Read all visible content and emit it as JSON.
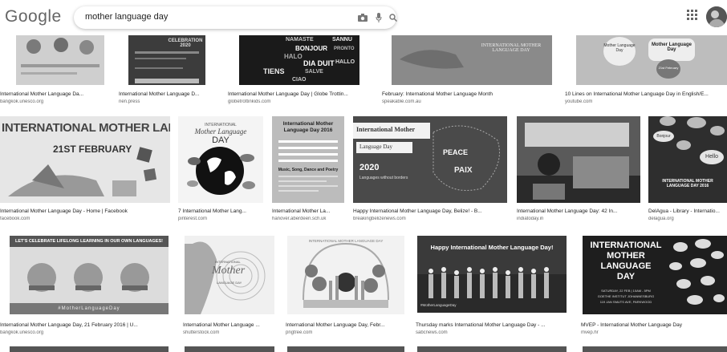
{
  "header": {
    "logo": "Google",
    "search_value": "mother language day",
    "icons": [
      "camera-icon",
      "mic-icon",
      "search-icon",
      "apps-icon",
      "avatar"
    ]
  },
  "rows": [
    {
      "items": [
        {
          "title": "International Mother Language Da...",
          "source": "bangkok.unesco.org"
        },
        {
          "title": "International Mother Language D...",
          "source": "nen.press"
        },
        {
          "title": "International Mother Language Day | Globe Trottin...",
          "source": "globetrottinkids.com"
        },
        {
          "title": "February: International Mother Language Month",
          "source": "speakable.com.au"
        },
        {
          "title": "10 Lines on International Mother Language Day in English/E...",
          "source": "youtube.com"
        }
      ]
    },
    {
      "items": [
        {
          "title": "International Mother Language Day - Home | Facebook",
          "source": "facebook.com"
        },
        {
          "title": "7 International Mother Lang...",
          "source": "pinterest.com"
        },
        {
          "title": "International Mother La...",
          "source": "hanover.aberdeen.sch.uk"
        },
        {
          "title": "Happy International Mother Language Day, Belize! - B...",
          "source": "breakingbelizenews.com"
        },
        {
          "title": "International Mother Language Day: 42 In...",
          "source": "indiatoday.in"
        },
        {
          "title": "DelAgua - Library - Internatio...",
          "source": "delagua.org"
        }
      ]
    },
    {
      "items": [
        {
          "title": "International Mother Language Day, 21 February 2016 | U...",
          "source": "bangkok.unesco.org"
        },
        {
          "title": "International Mother Language ...",
          "source": "shutterstock.com"
        },
        {
          "title": "International Mother Language Day, Febr...",
          "source": "pngtree.com"
        },
        {
          "title": "Thursday marks International Mother Language Day - ...",
          "source": "sabcnews.com"
        },
        {
          "title": "MVEP - International Mother Language Day",
          "source": "mvep.hr"
        }
      ]
    }
  ],
  "thumb_text": {
    "r0_1": "CELEBRATION 2020",
    "r0_2_words": [
      "NAMASTE",
      "SANNU",
      "BONJOUR",
      "PRONTO",
      "HALO",
      "DIA DUIT",
      "TIENS",
      "SALVE",
      "HALLO",
      "CIAO"
    ],
    "r0_3": "INTERNATIONAL MOTHER LANGUAGE DAY",
    "r0_4a": "Mother Language Day",
    "r0_4b": "Mother Language Day",
    "r0_4c": "21st February",
    "r1_0a": "INTERNATIONAL MOTHER LANGUAGE DAY",
    "r1_0b": "21ST FEBRUARY",
    "r1_1a": "INTERNATIONAL",
    "r1_1b": "Mother Language",
    "r1_1c": "DAY",
    "r1_2a": "International Mother Language Day 2016",
    "r1_2b": "Music, Song, Dance and Poetry",
    "r1_3a": "International Mother",
    "r1_3b": "Language Day",
    "r1_3c": "2020",
    "r1_3d": "Languages without borders",
    "r1_3e": "PEACE",
    "r1_3f": "PAIX",
    "r1_5a": "INTERNATIONAL MOTHER LANGUAGE DAY 2016",
    "r1_5b": "Bonjour",
    "r1_5c": "Hello",
    "r2_0a": "LET'S CELEBRATE LIFELONG LEARNING IN OUR OWN LANGUAGES!",
    "r2_0b": "#MotherLanguageDay",
    "r2_1a": "INTERNATIONAL",
    "r2_1b": "Mother",
    "r2_1c": "LANGUAGE DAY",
    "r2_2": "INTERNATIONAL MOTHER LANGUAGE DAY",
    "r2_3a": "Happy International Mother Language Day!",
    "r2_3b": "#MotherLanguageDay",
    "r2_4a": "INTERNATIONAL",
    "r2_4b": "MOTHER",
    "r2_4c": "LANGUAGE",
    "r2_4d": "DAY",
    "r2_4e": "SATURDAY, 22 FEB | 10AM - 5PM",
    "r2_4f": "GOETHE INSTITUT JOHANNESBURG",
    "r2_4g": "119 JAN SMUTS AVE, PARKWOOD"
  }
}
